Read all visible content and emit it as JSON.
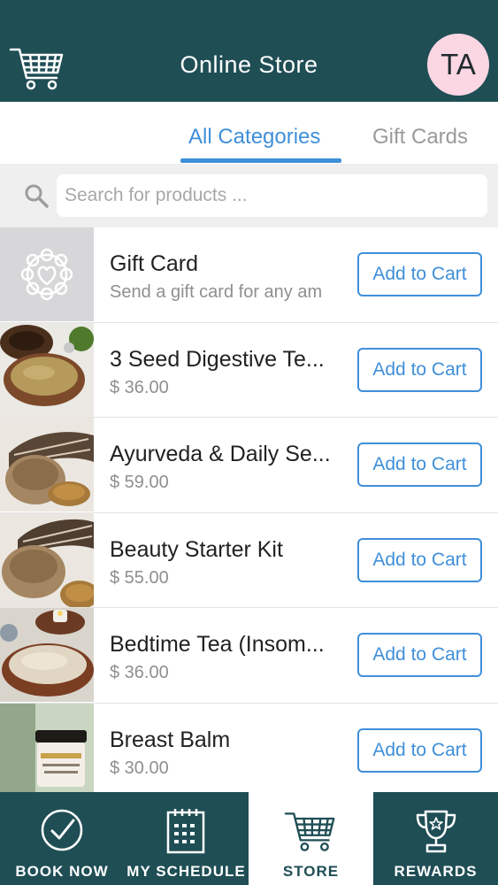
{
  "header": {
    "title": "Online Store",
    "avatar_initials": "TA",
    "cart_icon": "shopping-cart-icon"
  },
  "tabs": [
    {
      "label": "All Categories",
      "active": true
    },
    {
      "label": "Gift Cards",
      "active": false
    }
  ],
  "search": {
    "placeholder": "Search for products ...",
    "icon": "search-icon"
  },
  "products": [
    {
      "name": "Gift Card",
      "subtitle": "Send a gift card for any am",
      "button": "Add to Cart",
      "image": "gift-card-emblem"
    },
    {
      "name": "3 Seed Digestive Te...",
      "subtitle": "$ 36.00",
      "button": "Add to Cart",
      "image": "tea-powder-bowl"
    },
    {
      "name": "Ayurveda & Daily Se...",
      "subtitle": "$ 59.00",
      "button": "Add to Cart",
      "image": "burlap-sack-feather"
    },
    {
      "name": "Beauty Starter Kit",
      "subtitle": "$ 55.00",
      "button": "Add to Cart",
      "image": "burlap-sack-feather"
    },
    {
      "name": "Bedtime Tea (Insom...",
      "subtitle": "$ 36.00",
      "button": "Add to Cart",
      "image": "tea-bowl-candle"
    },
    {
      "name": "Breast Balm",
      "subtitle": "$ 30.00",
      "button": "Add to Cart",
      "image": "balm-jar"
    }
  ],
  "bottom_nav": [
    {
      "label": "BOOK NOW",
      "icon": "check-circle-icon",
      "active": false
    },
    {
      "label": "MY SCHEDULE",
      "icon": "calendar-icon",
      "active": false
    },
    {
      "label": "STORE",
      "icon": "shopping-cart-icon",
      "active": true
    },
    {
      "label": "REWARDS",
      "icon": "trophy-icon",
      "active": false
    }
  ],
  "colors": {
    "header_bg": "#1f4e55",
    "accent": "#3f8fd9",
    "avatar_bg": "#fbd6e3"
  }
}
